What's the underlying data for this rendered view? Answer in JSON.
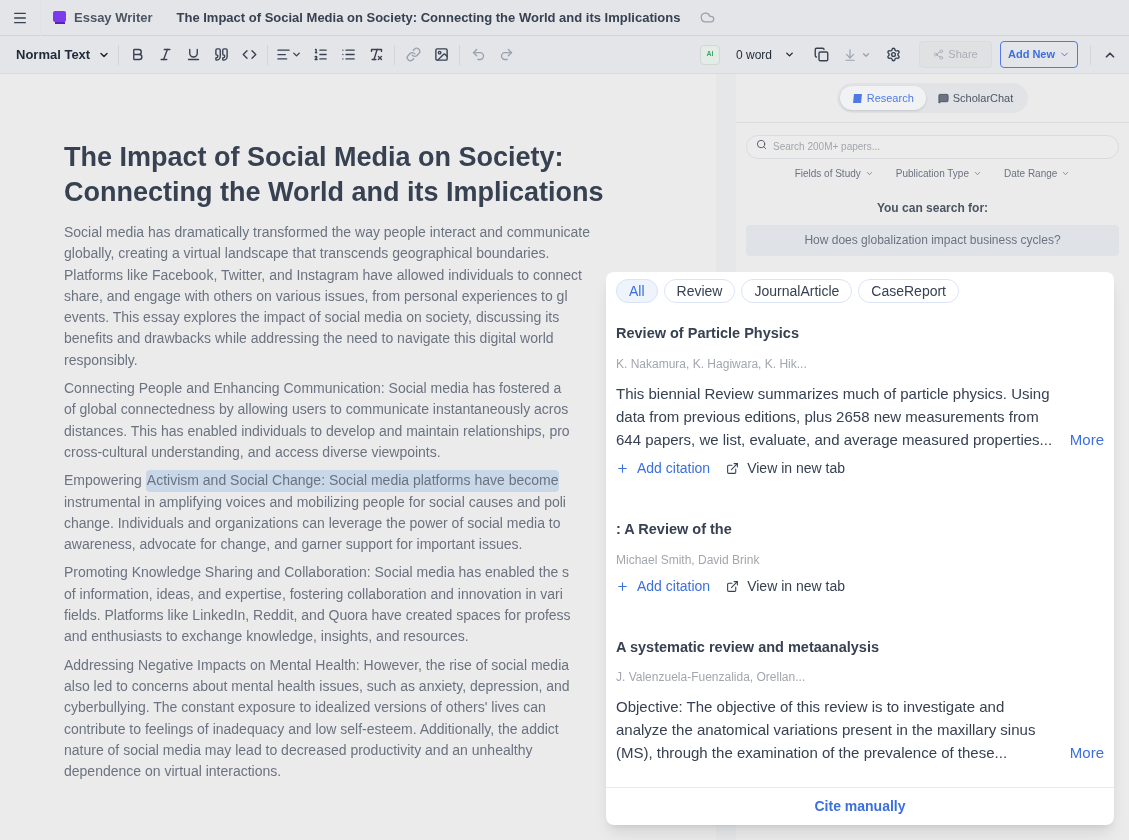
{
  "top_bar": {
    "app_name": "Essay Writer",
    "document_title": "The Impact of Social Media on Society: Connecting the World and its Implications"
  },
  "toolbar": {
    "text_style": "Normal Text",
    "ai_badge": "AI",
    "word_count": "0 word",
    "share": "Share",
    "add_new": "Add New"
  },
  "document": {
    "title": "The Impact of Social Media on Society: Connecting the World and its Implications",
    "paragraphs": [
      {
        "lines": [
          [
            {
              "text": "Social media has dramatically transformed the way people interact and communicate",
              "selected": false
            }
          ],
          [
            {
              "text": "globally, creating a virtual landscape that transcends geographical boundaries.",
              "selected": false
            }
          ],
          [
            {
              "text": "Platforms like Facebook, Twitter, and Instagram have allowed individuals to connect",
              "selected": false
            }
          ],
          [
            {
              "text": "share, and engage with others on various issues, from personal experiences to gl",
              "selected": false
            }
          ],
          [
            {
              "text": "events. This essay explores the impact of social media on society, discussing its",
              "selected": false
            }
          ],
          [
            {
              "text": "benefits and drawbacks while addressing the need to navigate this digital world",
              "selected": false
            }
          ],
          [
            {
              "text": "responsibly.",
              "selected": false
            }
          ]
        ]
      },
      {
        "lines": [
          [
            {
              "text": "Connecting People and Enhancing Communication: Social media has fostered a",
              "selected": false
            }
          ],
          [
            {
              "text": "of global connectedness by allowing users to communicate instantaneously acros",
              "selected": false
            }
          ],
          [
            {
              "text": "distances. This has enabled individuals to develop and maintain relationships, pro",
              "selected": false
            }
          ],
          [
            {
              "text": "cross-cultural understanding, and access diverse viewpoints.",
              "selected": false
            }
          ]
        ]
      },
      {
        "lines": [
          [
            {
              "text": "Empowering",
              "selected": false
            },
            {
              "text": "Activism and Social Change: Social media platforms have become",
              "selected": true
            }
          ],
          [
            {
              "text": "instrumental in amplifying voices and mobilizing people for social causes and poli",
              "selected": false
            }
          ],
          [
            {
              "text": "change. Individuals and organizations can leverage the power of social media to",
              "selected": false
            }
          ],
          [
            {
              "text": "awareness, advocate for change, and garner support for important issues.",
              "selected": false
            }
          ]
        ]
      },
      {
        "lines": [
          [
            {
              "text": "Promoting Knowledge Sharing and Collaboration: Social media has enabled the s",
              "selected": false
            }
          ],
          [
            {
              "text": "of information, ideas, and expertise, fostering collaboration and innovation in vari",
              "selected": false
            }
          ],
          [
            {
              "text": "fields. Platforms like LinkedIn, Reddit, and Quora have created spaces for profess",
              "selected": false
            }
          ],
          [
            {
              "text": "and enthusiasts to exchange knowledge, insights, and resources.",
              "selected": false
            }
          ]
        ]
      },
      {
        "lines": [
          [
            {
              "text": "Addressing Negative Impacts on Mental Health: However, the rise of social media",
              "selected": false
            }
          ],
          [
            {
              "text": "also led to concerns about mental health issues, such as anxiety, depression, and",
              "selected": false
            }
          ],
          [
            {
              "text": "cyberbullying. The constant exposure to idealized versions of others' lives can",
              "selected": false
            }
          ],
          [
            {
              "text": "contribute to feelings of inadequacy and low self-esteem. Additionally, the addict",
              "selected": false
            }
          ],
          [
            {
              "text": "nature of social media may lead to decreased productivity and an unhealthy",
              "selected": false
            }
          ],
          [
            {
              "text": "dependence on virtual interactions.",
              "selected": false
            }
          ]
        ]
      }
    ]
  },
  "research_panel": {
    "tabs": [
      {
        "label": "Research",
        "selected": true
      },
      {
        "label": "ScholarChat",
        "selected": false
      }
    ],
    "search": {
      "placeholder": "Search 200M+ papers..."
    },
    "filters": [
      "Fields of Study",
      "Publication Type",
      "Date Range"
    ],
    "suggestions_heading": "You can search for:",
    "suggestion": "How does globalization impact business cycles?"
  },
  "results_popup": {
    "chips": [
      {
        "label": "All",
        "selected": true
      },
      {
        "label": "Review",
        "selected": false
      },
      {
        "label": "JournalArticle",
        "selected": false
      },
      {
        "label": "CaseReport",
        "selected": false
      }
    ],
    "results": [
      {
        "title": "Review of Particle Physics",
        "authors": "K. Nakamura, K. Hagiwara, K. Hik...",
        "abstract": "This biennial Review summarizes much of particle physics. Using data from previous editions, plus 2658 new measurements from 644 papers, we list, evaluate, and average measured properties...",
        "more": "More",
        "add_citation": "Add citation",
        "view_link": "View in new tab"
      },
      {
        "title": ": A Review of the",
        "authors": "Michael Smith, David Brink",
        "add_citation": "Add citation",
        "view_link": "View in new tab"
      },
      {
        "title": "A systematic review and metaanalysis",
        "authors": "J. Valenzuela-Fuenzalida, Orellan...",
        "abstract": "Objective: The objective of this review is to investigate and analyze the anatomical variations present in the maxillary sinus (MS), through the examination of the prevalence of these...",
        "more": "More"
      }
    ],
    "cite_manually": "Cite manually"
  }
}
